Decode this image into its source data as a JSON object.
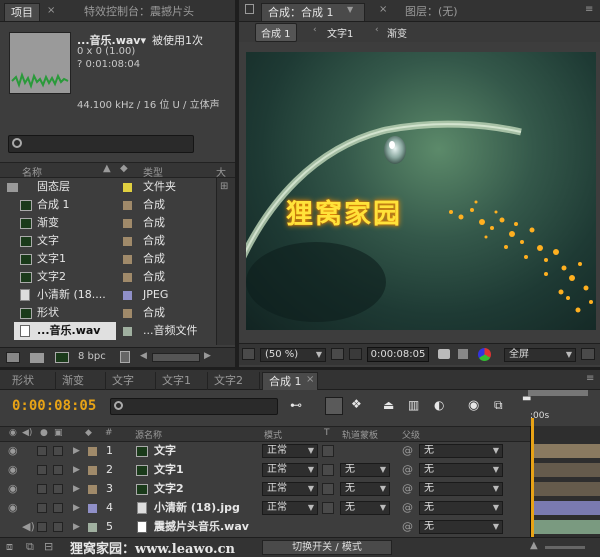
{
  "project": {
    "tabs": [
      {
        "label": "项目"
      },
      {
        "label": "特效控制台：震撼片头"
      }
    ],
    "file": {
      "name": "...音乐.wav▾",
      "usage": "被使用1次",
      "size": "0 x 0 (1.00)",
      "duration": "? 0:01:08:04",
      "audio": "44.100 kHz / 16 位 U / 立体声"
    },
    "columns": {
      "name": "名称",
      "type": "类型",
      "size": "大小"
    },
    "items": [
      {
        "name": "固态层",
        "type": "文件夹",
        "color": "#e0d040",
        "icon": "folder-icon"
      },
      {
        "name": "合成 1",
        "type": "合成",
        "color": "#a08a6a",
        "icon": "composition-icon"
      },
      {
        "name": "渐变",
        "type": "合成",
        "color": "#a08a6a",
        "icon": "composition-icon"
      },
      {
        "name": "文字",
        "type": "合成",
        "color": "#a08a6a",
        "icon": "composition-icon"
      },
      {
        "name": "文字1",
        "type": "合成",
        "color": "#a08a6a",
        "icon": "composition-icon"
      },
      {
        "name": "文字2",
        "type": "合成",
        "color": "#a08a6a",
        "icon": "composition-icon"
      },
      {
        "name": "小清新 (18....",
        "type": "JPEG",
        "color": "#9090c8",
        "icon": "jpeg-file-icon"
      },
      {
        "name": "形状",
        "type": "合成",
        "color": "#a08a6a",
        "icon": "composition-icon"
      },
      {
        "name": "...音乐.wav",
        "type": "...音频文件",
        "color": "#a0b0a0",
        "icon": "audio-file-icon"
      }
    ],
    "bpc": "8 bpc"
  },
  "viewer": {
    "tabs": [
      {
        "label": "合成：合成 1"
      },
      {
        "label": "图层：(无)"
      }
    ],
    "breadcrumbs": [
      {
        "label": "合成 1"
      },
      {
        "label": "文字1"
      },
      {
        "label": "渐变"
      }
    ],
    "overlay_text": "狸窝家园",
    "zoom": "(50 %)",
    "timecode": "0:00:08:05",
    "resolution": "全屏"
  },
  "timeline": {
    "tabs": [
      {
        "label": "形状"
      },
      {
        "label": "渐变"
      },
      {
        "label": "文字"
      },
      {
        "label": "文字1"
      },
      {
        "label": "文字2"
      },
      {
        "label": "合成 1"
      }
    ],
    "current_time": "0:00:08:05",
    "ruler": ":00s",
    "columns": {
      "source": "源名称",
      "mode": "模式",
      "t": "T",
      "trkmat": "轨道蒙板",
      "parent": "父级",
      "num": "#"
    },
    "layers": [
      {
        "num": "1",
        "name": "文字",
        "mode": "正常",
        "trkmat": "",
        "parent": "无",
        "color": "#a08a6a",
        "icon": "composition-icon",
        "bar": "#8a7a60"
      },
      {
        "num": "2",
        "name": "文字1",
        "mode": "正常",
        "trkmat": "无",
        "parent": "无",
        "color": "#a08a6a",
        "icon": "composition-icon",
        "bar": "#8a7a60"
      },
      {
        "num": "3",
        "name": "文字2",
        "mode": "正常",
        "trkmat": "无",
        "parent": "无",
        "color": "#a08a6a",
        "icon": "composition-icon",
        "bar": "#8a7a60"
      },
      {
        "num": "4",
        "name": "小清新 (18).jpg",
        "mode": "正常",
        "trkmat": "无",
        "parent": "无",
        "color": "#9090c8",
        "icon": "jpeg-file-icon",
        "bar": "#7a7ab0"
      },
      {
        "num": "5",
        "name": "震撼片头音乐.wav",
        "mode": "",
        "trkmat": "",
        "parent": "无",
        "color": "#a0b0a0",
        "icon": "audio-file-icon",
        "bar": "#7a9a80"
      }
    ],
    "toggle_label": "切换开关 / 模式",
    "watermark": "狸窝家园：www.leawo.cn"
  }
}
